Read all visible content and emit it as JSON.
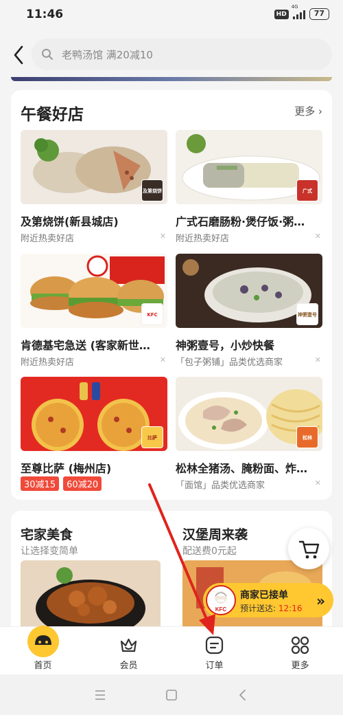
{
  "status_bar": {
    "time": "11:46",
    "hd": "HD",
    "network": "4G",
    "battery": "77"
  },
  "search": {
    "placeholder": "老鸭汤馆 满20减10"
  },
  "lunch_section": {
    "title": "午餐好店",
    "more_label": "更多",
    "shops": [
      {
        "name": "及第烧饼(新县城店)",
        "subtitle": "附近热卖好店",
        "logo_text": "及第烧饼"
      },
      {
        "name": "广式石磨肠粉·煲仔饭·粥…",
        "subtitle": "附近热卖好店",
        "logo_text": "广式"
      },
      {
        "name": "肯德基宅急送 (客家新世…",
        "subtitle": "附近热卖好店",
        "logo_text": "KFC"
      },
      {
        "name": "神粥壹号，小炒快餐",
        "subtitle": "「包子粥铺」品类优选商家",
        "logo_text": "神粥壹号"
      },
      {
        "name": "至尊比萨 (梅州店)",
        "badges": [
          "30减15",
          "60减20"
        ],
        "logo_text": "比萨"
      },
      {
        "name": "松林全猪汤、腌粉面、炸…",
        "subtitle": "「面馆」品类优选商家",
        "logo_text": "松林"
      }
    ]
  },
  "promo_section": {
    "left": {
      "title": "宅家美食",
      "subtitle": "让选择变简单"
    },
    "right": {
      "title": "汉堡周来袭",
      "subtitle": "配送费0元起"
    }
  },
  "order_status": {
    "status": "商家已接单",
    "eta_label": "预计送达:",
    "eta_time": "12:16"
  },
  "tabbar": {
    "tabs": [
      {
        "label": "首页"
      },
      {
        "label": "会员"
      },
      {
        "label": "订单"
      },
      {
        "label": "更多"
      }
    ]
  },
  "colors": {
    "accent_yellow": "#ffc730",
    "badge_red": "#f04a3a",
    "arrow_red": "#e0231c"
  }
}
